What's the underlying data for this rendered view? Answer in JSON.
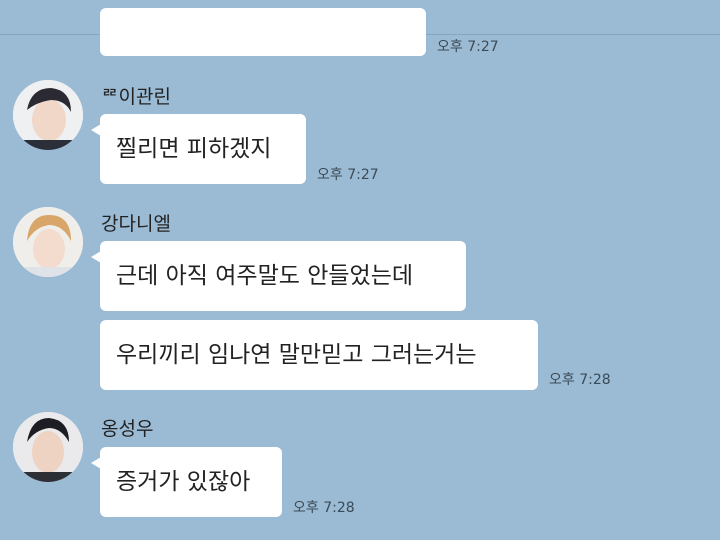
{
  "messages": {
    "partial": {
      "time": "오후 7:27"
    },
    "m1": {
      "sender": "ᄙ이관린",
      "text": "찔리면 피하겠지",
      "time": "오후 7:27"
    },
    "m2": {
      "sender": "강다니엘",
      "text1": "근데 아직 여주말도 안들었는데",
      "text2": "우리끼리 임나연 말만믿고 그러는거는",
      "time": "오후 7:28"
    },
    "m3": {
      "sender": "옹성우",
      "text": "증거가 있잖아",
      "time": "오후 7:28"
    }
  },
  "colors": {
    "background": "#9bbbd4",
    "bubble": "#ffffff"
  },
  "icons": {
    "avatar1": "profile-photo-guanlin",
    "avatar2": "profile-photo-daniel",
    "avatar3": "profile-photo-seongwu"
  }
}
